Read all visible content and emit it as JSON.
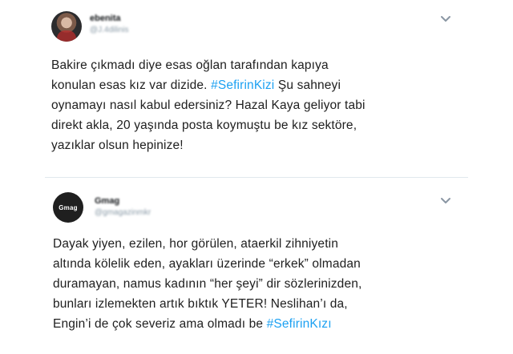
{
  "tweets": [
    {
      "author_name": "ebenita",
      "author_handle": "@J.4dilinis",
      "text": {
        "line1": "Bakire çıkmadı diye esas oğlan tarafından kapıya",
        "line2_before": "konulan esas kız var dizide. ",
        "line2_hashtag": "#SefirinKizi",
        "line2_after": " Şu sahneyi",
        "line3": "oynamayı nasıl kabul edersiniz? Hazal Kaya geliyor tabi",
        "line4": "direkt akla, 20 yaşında posta koymuştu be kız sektöre,",
        "line5": "yazıklar olsun hepinize!"
      }
    },
    {
      "author_name": "Gmag",
      "author_handle": "@gmagazinmkr",
      "avatar_wordmark": "Gmag",
      "text": {
        "line1": "Dayak yiyen, ezilen, hor görülen, ataerkil zihniyetin",
        "line2": "altında kölelik eden, ayakları üzerinde “erkek” olmadan",
        "line3": "duramayan, namus kadının “her şeyi” dir sözlerinizden,",
        "line4": "bunları izlemekten artık bıktık YETER! Neslihan’ı da,",
        "line5_before": "Engin’i de çok severiz ama olmadı be ",
        "line5_hashtag": "#SefirinKızı"
      }
    }
  ],
  "icons": {
    "more": "chevron-down-icon"
  },
  "colors": {
    "hashtag": "#1da1f2",
    "text": "#202020",
    "divider": "#e1e8ed"
  }
}
